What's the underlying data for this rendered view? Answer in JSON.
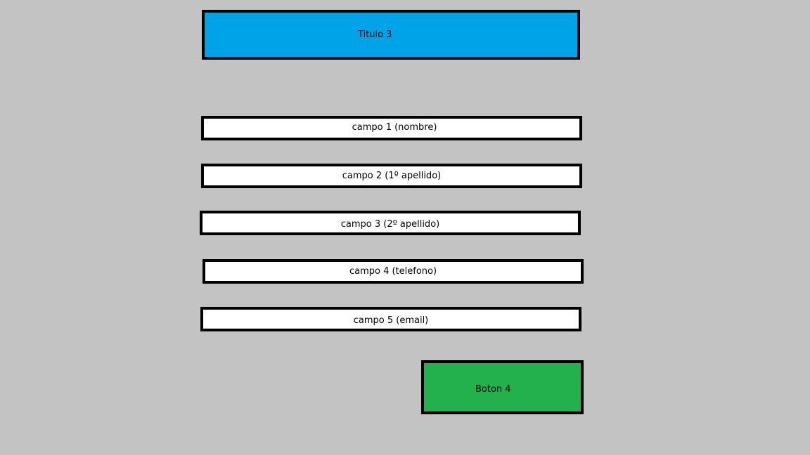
{
  "header": {
    "title": "Titulo 3",
    "color": "#00a2e8"
  },
  "form": {
    "fields": [
      {
        "label": "campo 1 (nombre)"
      },
      {
        "label": "campo 2 (1º apellido)"
      },
      {
        "label": "campo 3 (2º apellido)"
      },
      {
        "label": "campo 4 (telefono)"
      },
      {
        "label": "campo 5 (email)"
      }
    ],
    "field_color": "#ffffff"
  },
  "action": {
    "button_label": "Boton 4",
    "color": "#22b14c"
  },
  "background": "#c3c3c3"
}
